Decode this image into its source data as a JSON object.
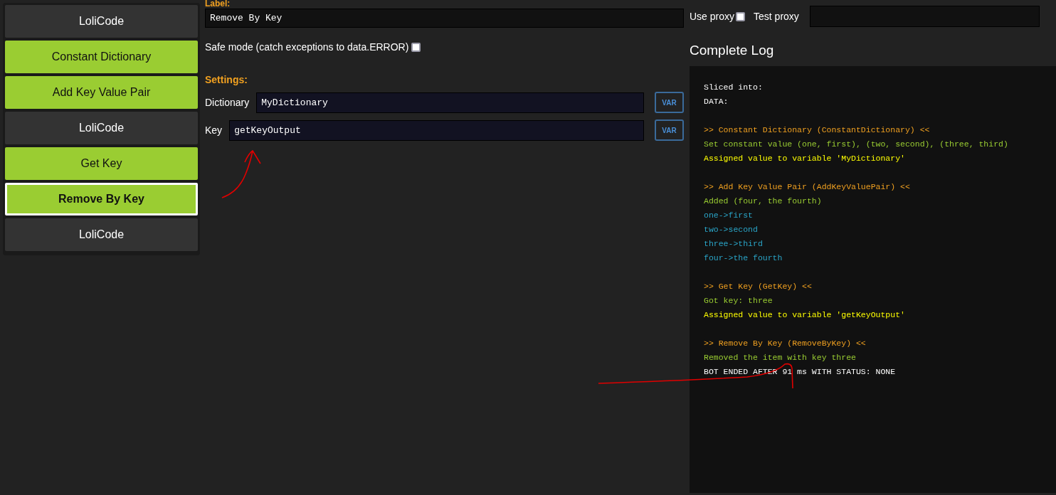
{
  "sidebar": {
    "items": [
      {
        "label": "LoliCode",
        "kind": "loli",
        "selected": false
      },
      {
        "label": "Constant Dictionary",
        "kind": "block",
        "selected": false
      },
      {
        "label": "Add Key Value Pair",
        "kind": "block",
        "selected": false
      },
      {
        "label": "LoliCode",
        "kind": "loli",
        "selected": false
      },
      {
        "label": "Get Key",
        "kind": "block",
        "selected": false
      },
      {
        "label": "Remove By Key",
        "kind": "block",
        "selected": true
      },
      {
        "label": "LoliCode",
        "kind": "loli",
        "selected": false
      }
    ]
  },
  "editor": {
    "label_heading": "Label:",
    "label_value": "Remove By Key",
    "safe_mode": {
      "label": "Safe mode (catch exceptions to data.ERROR)",
      "checked": false
    },
    "settings_heading": "Settings:",
    "settings": [
      {
        "label": "Dictionary",
        "value": "MyDictionary",
        "button": "VAR"
      },
      {
        "label": "Key",
        "value": "getKeyOutput",
        "button": "VAR"
      }
    ]
  },
  "proxy": {
    "use_proxy": {
      "label": "Use proxy",
      "checked": false
    },
    "test_label": "Test proxy"
  },
  "log": {
    "title": "Complete Log",
    "blocks": [
      {
        "lines": [
          {
            "text": "Sliced into:",
            "kind": "plain"
          },
          {
            "text": "DATA:",
            "kind": "plain"
          }
        ]
      },
      {
        "lines": [
          {
            "text": ">> Constant Dictionary (ConstantDictionary) <<",
            "kind": "header"
          },
          {
            "text": "Set constant value (one, first), (two, second), (three, third)",
            "kind": "info"
          },
          {
            "text": "Assigned value to variable 'MyDictionary'",
            "kind": "assign"
          }
        ]
      },
      {
        "lines": [
          {
            "text": ">> Add Key Value Pair (AddKeyValuePair) <<",
            "kind": "header"
          },
          {
            "text": "Added (four, the fourth)",
            "kind": "info"
          },
          {
            "text": "one->first",
            "kind": "item"
          },
          {
            "text": "two->second",
            "kind": "item"
          },
          {
            "text": "three->third",
            "kind": "item"
          },
          {
            "text": "four->the fourth",
            "kind": "item"
          }
        ]
      },
      {
        "lines": [
          {
            "text": ">> Get Key (GetKey) <<",
            "kind": "header"
          },
          {
            "text": "Got key: three",
            "kind": "info"
          },
          {
            "text": "Assigned value to variable 'getKeyOutput'",
            "kind": "assign"
          }
        ]
      },
      {
        "lines": [
          {
            "text": ">> Remove By Key (RemoveByKey) <<",
            "kind": "header"
          },
          {
            "text": "Removed the item with key three",
            "kind": "info"
          },
          {
            "text": "BOT ENDED AFTER 91 ms WITH STATUS: NONE",
            "kind": "plain"
          }
        ]
      }
    ]
  }
}
